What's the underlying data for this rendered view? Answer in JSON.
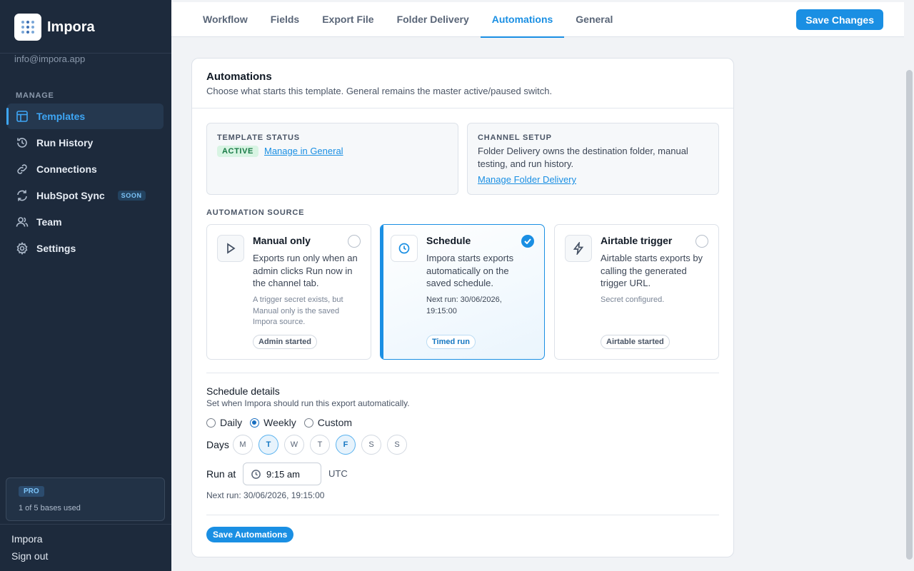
{
  "app": {
    "name": "Impora",
    "account_email": "info@impora.app"
  },
  "sidebar": {
    "section_heading": "MANAGE",
    "items": [
      {
        "label": "Templates",
        "icon": "layout-icon",
        "active": true
      },
      {
        "label": "Run History",
        "icon": "history-icon"
      },
      {
        "label": "Connections",
        "icon": "link-icon"
      },
      {
        "label": "HubSpot Sync",
        "icon": "sync-icon",
        "badge": "SOON"
      },
      {
        "label": "Team",
        "icon": "users-icon"
      },
      {
        "label": "Settings",
        "icon": "gear-icon"
      }
    ],
    "plan": {
      "badge": "PRO",
      "usage": "1 of 5 bases used"
    },
    "workspace": "Impora",
    "sign_out": "Sign out"
  },
  "tabs": [
    {
      "label": "Workflow"
    },
    {
      "label": "Fields"
    },
    {
      "label": "Export File"
    },
    {
      "label": "Folder Delivery"
    },
    {
      "label": "Automations",
      "active": true
    },
    {
      "label": "General"
    }
  ],
  "toolbar": {
    "save_label": "Save Changes"
  },
  "automations": {
    "title": "Automations",
    "description": "Choose what starts this template. General remains the master active/paused switch.",
    "template_status": {
      "heading": "TEMPLATE STATUS",
      "badge": "ACTIVE",
      "link": "Manage in General",
      "badge_color": "#177a45"
    },
    "channel_setup": {
      "heading": "CHANNEL SETUP",
      "text": "Folder Delivery owns the destination folder, manual testing, and run history.",
      "link": "Manage Folder Delivery"
    },
    "source_heading": "AUTOMATION SOURCE",
    "sources": [
      {
        "title": "Manual only",
        "icon": "play-icon",
        "description": "Exports run only when an admin clicks Run now in the channel tab.",
        "note": "A trigger secret exists, but Manual only is the saved Impora source.",
        "chip": "Admin started",
        "selected": false
      },
      {
        "title": "Schedule",
        "icon": "clock-icon",
        "description": "Impora starts exports automatically on the saved schedule.",
        "note": "Next run: 30/06/2026, 19:15:00",
        "chip": "Timed run",
        "selected": true
      },
      {
        "title": "Airtable trigger",
        "icon": "lightning-icon",
        "description": "Airtable starts exports by calling the generated trigger URL.",
        "note": "Secret configured.",
        "chip": "Airtable started",
        "selected": false
      }
    ],
    "schedule": {
      "title": "Schedule details",
      "description": "Set when Impora should run this export automatically.",
      "frequency_options": [
        "Daily",
        "Weekly",
        "Custom"
      ],
      "frequency_selected": "Weekly",
      "days_label": "Days",
      "days": [
        {
          "label": "M",
          "on": false
        },
        {
          "label": "T",
          "on": true
        },
        {
          "label": "W",
          "on": false
        },
        {
          "label": "T",
          "on": false
        },
        {
          "label": "F",
          "on": true
        },
        {
          "label": "S",
          "on": false
        },
        {
          "label": "S",
          "on": false
        }
      ],
      "run_at_label": "Run at",
      "time": "9:15 am",
      "timezone": "UTC",
      "next_run": "Next run: 30/06/2026, 19:15:00"
    },
    "save_label": "Save Automations"
  },
  "colors": {
    "accent": "#1a8fe3",
    "sidebar_bg": "#1d2a3c",
    "active_badge_bg": "#d8f4e3"
  }
}
